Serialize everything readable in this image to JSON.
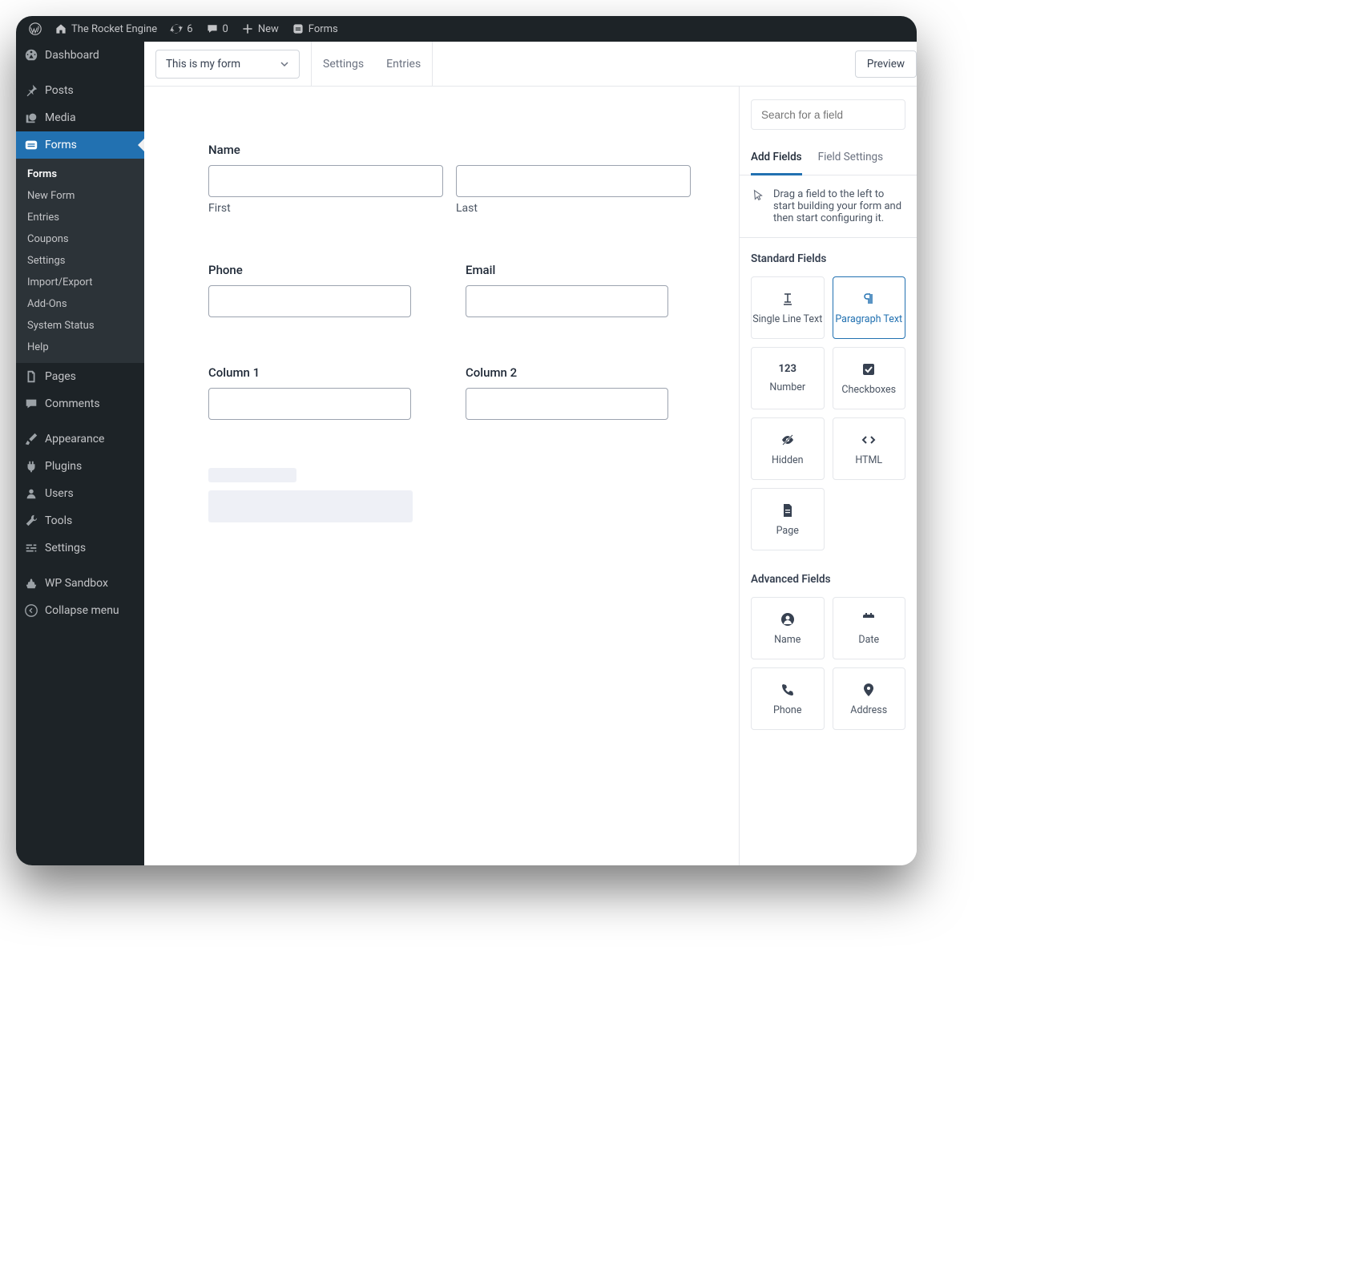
{
  "adminbar": {
    "site_name": "The Rocket Engine",
    "updates": "6",
    "comments": "0",
    "new_label": "New",
    "context_label": "Forms"
  },
  "sidebar": {
    "dashboard": "Dashboard",
    "posts": "Posts",
    "media": "Media",
    "forms": "Forms",
    "forms_sub": {
      "forms": "Forms",
      "new_form": "New Form",
      "entries": "Entries",
      "coupons": "Coupons",
      "settings": "Settings",
      "import_export": "Import/Export",
      "addons": "Add-Ons",
      "system_status": "System Status",
      "help": "Help"
    },
    "pages": "Pages",
    "comments": "Comments",
    "appearance": "Appearance",
    "plugins": "Plugins",
    "users": "Users",
    "tools": "Tools",
    "settings": "Settings",
    "wp_sandbox": "WP Sandbox",
    "collapse": "Collapse menu"
  },
  "topbar": {
    "form_title": "This is my form",
    "settings": "Settings",
    "entries": "Entries",
    "preview": "Preview"
  },
  "canvas": {
    "name_label": "Name",
    "first_label": "First",
    "last_label": "Last",
    "phone_label": "Phone",
    "email_label": "Email",
    "col1_label": "Column 1",
    "col2_label": "Column 2"
  },
  "panel": {
    "search_placeholder": "Search for a field",
    "tab_add": "Add Fields",
    "tab_settings": "Field Settings",
    "hint": "Drag a field to the left to start building your form and then start configuring it.",
    "standard_title": "Standard Fields",
    "standard": {
      "single_line": "Single Line Text",
      "paragraph": "Paragraph Text",
      "number": "Number",
      "checkboxes": "Checkboxes",
      "hidden": "Hidden",
      "html": "HTML",
      "page": "Page"
    },
    "advanced_title": "Advanced Fields",
    "advanced": {
      "name": "Name",
      "date": "Date",
      "phone": "Phone",
      "address": "Address"
    }
  }
}
